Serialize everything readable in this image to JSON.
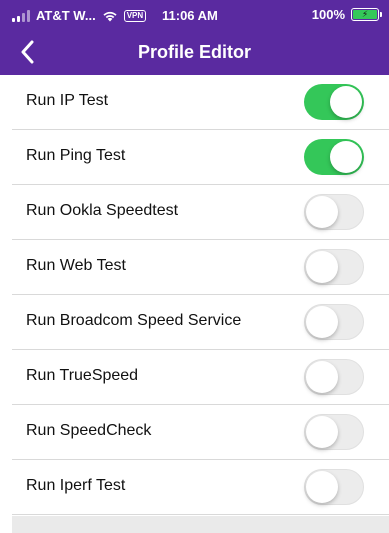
{
  "status_bar": {
    "carrier": "AT&T W...",
    "vpn": "VPN",
    "time": "11:06 AM",
    "battery": "100%"
  },
  "header": {
    "title": "Profile Editor",
    "back_icon": "chevron-left-icon"
  },
  "colors": {
    "header_bg": "#5a2aa0",
    "toggle_on": "#34c759"
  },
  "settings": [
    {
      "label": "Run IP Test",
      "on": true
    },
    {
      "label": "Run Ping Test",
      "on": true
    },
    {
      "label": "Run Ookla Speedtest",
      "on": false
    },
    {
      "label": "Run Web Test",
      "on": false
    },
    {
      "label": "Run Broadcom Speed Service",
      "on": false
    },
    {
      "label": "Run TrueSpeed",
      "on": false
    },
    {
      "label": "Run SpeedCheck",
      "on": false
    },
    {
      "label": "Run Iperf Test",
      "on": false
    }
  ]
}
